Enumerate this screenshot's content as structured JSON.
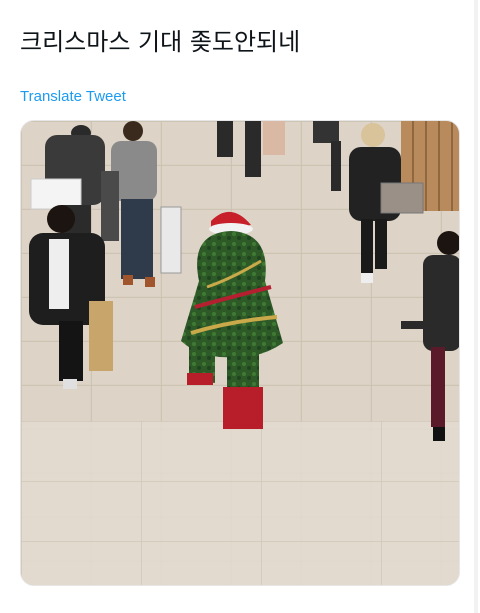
{
  "tweet": {
    "text": "크리스마스 기대 좆도안되네",
    "translate_label": "Translate Tweet"
  },
  "media": {
    "description_icon": "photo-icon"
  }
}
